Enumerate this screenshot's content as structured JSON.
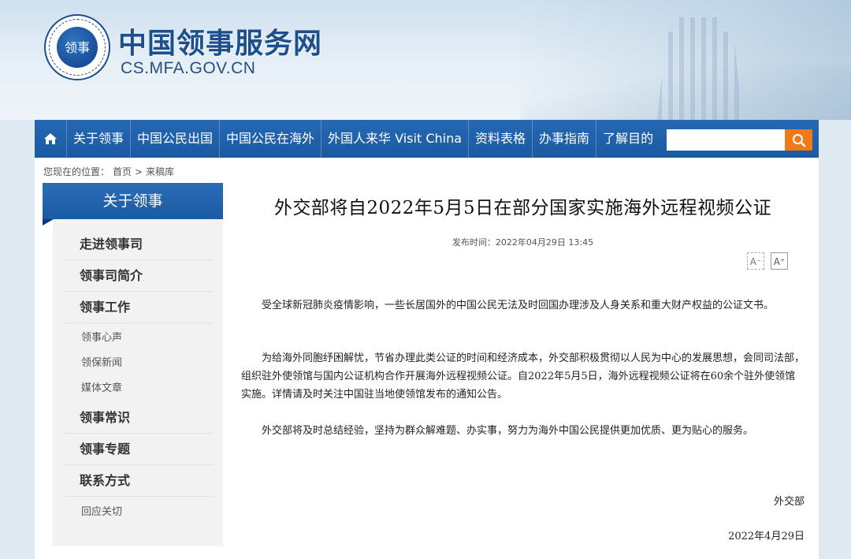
{
  "header": {
    "title": "中国领事服务网",
    "domain": "CS.MFA.GOV.CN",
    "seal_char": "领事"
  },
  "nav": {
    "home_icon": "home-icon",
    "items": [
      "关于领事",
      "中国公民出国",
      "中国公民在海外",
      "外国人来华 Visit China",
      "资料表格",
      "办事指南",
      "了解目的"
    ],
    "search_placeholder": "",
    "search_icon": "search-icon"
  },
  "breadcrumb": {
    "prefix": "您现在的位置：",
    "home": "首页",
    "sep": ">",
    "current": "来稿库"
  },
  "sidebar": {
    "heading": "关于领事",
    "items": [
      {
        "label": "走进领事司",
        "level": "major"
      },
      {
        "label": "领事司简介",
        "level": "major"
      },
      {
        "label": "领事工作",
        "level": "major"
      },
      {
        "label": "领事心声",
        "level": "minor"
      },
      {
        "label": "领保新闻",
        "level": "minor"
      },
      {
        "label": "媒体文章",
        "level": "minor"
      },
      {
        "label": "领事常识",
        "level": "major"
      },
      {
        "label": "领事专题",
        "level": "major"
      },
      {
        "label": "联系方式",
        "level": "major"
      },
      {
        "label": "回应关切",
        "level": "minor"
      }
    ]
  },
  "article": {
    "title": "外交部将自2022年5月5日在部分国家实施海外远程视频公证",
    "meta": "发布时间：2022年04月29日 13:45",
    "font_decrease": "A⁻",
    "font_increase": "A⁺",
    "paragraphs": [
      "受全球新冠肺炎疫情影响，一些长居国外的中国公民无法及时回国办理涉及人身关系和重大财产权益的公证文书。",
      "为给海外同胞纾困解忧，节省办理此类公证的时间和经济成本，外交部积极贯彻以人民为中心的发展思想，会同司法部，组织驻外使领馆与国内公证机构合作开展海外远程视频公证。自2022年5月5日，海外远程视频公证将在60余个驻外使领馆实施。详情请及时关注中国驻当地使领馆发布的通知公告。",
      "外交部将及时总结经验，坚持为群众解难题、办实事，努力为海外中国公民提供更加优质、更为贴心的服务。"
    ],
    "signature": "外交部",
    "date": "2022年4月29日"
  }
}
